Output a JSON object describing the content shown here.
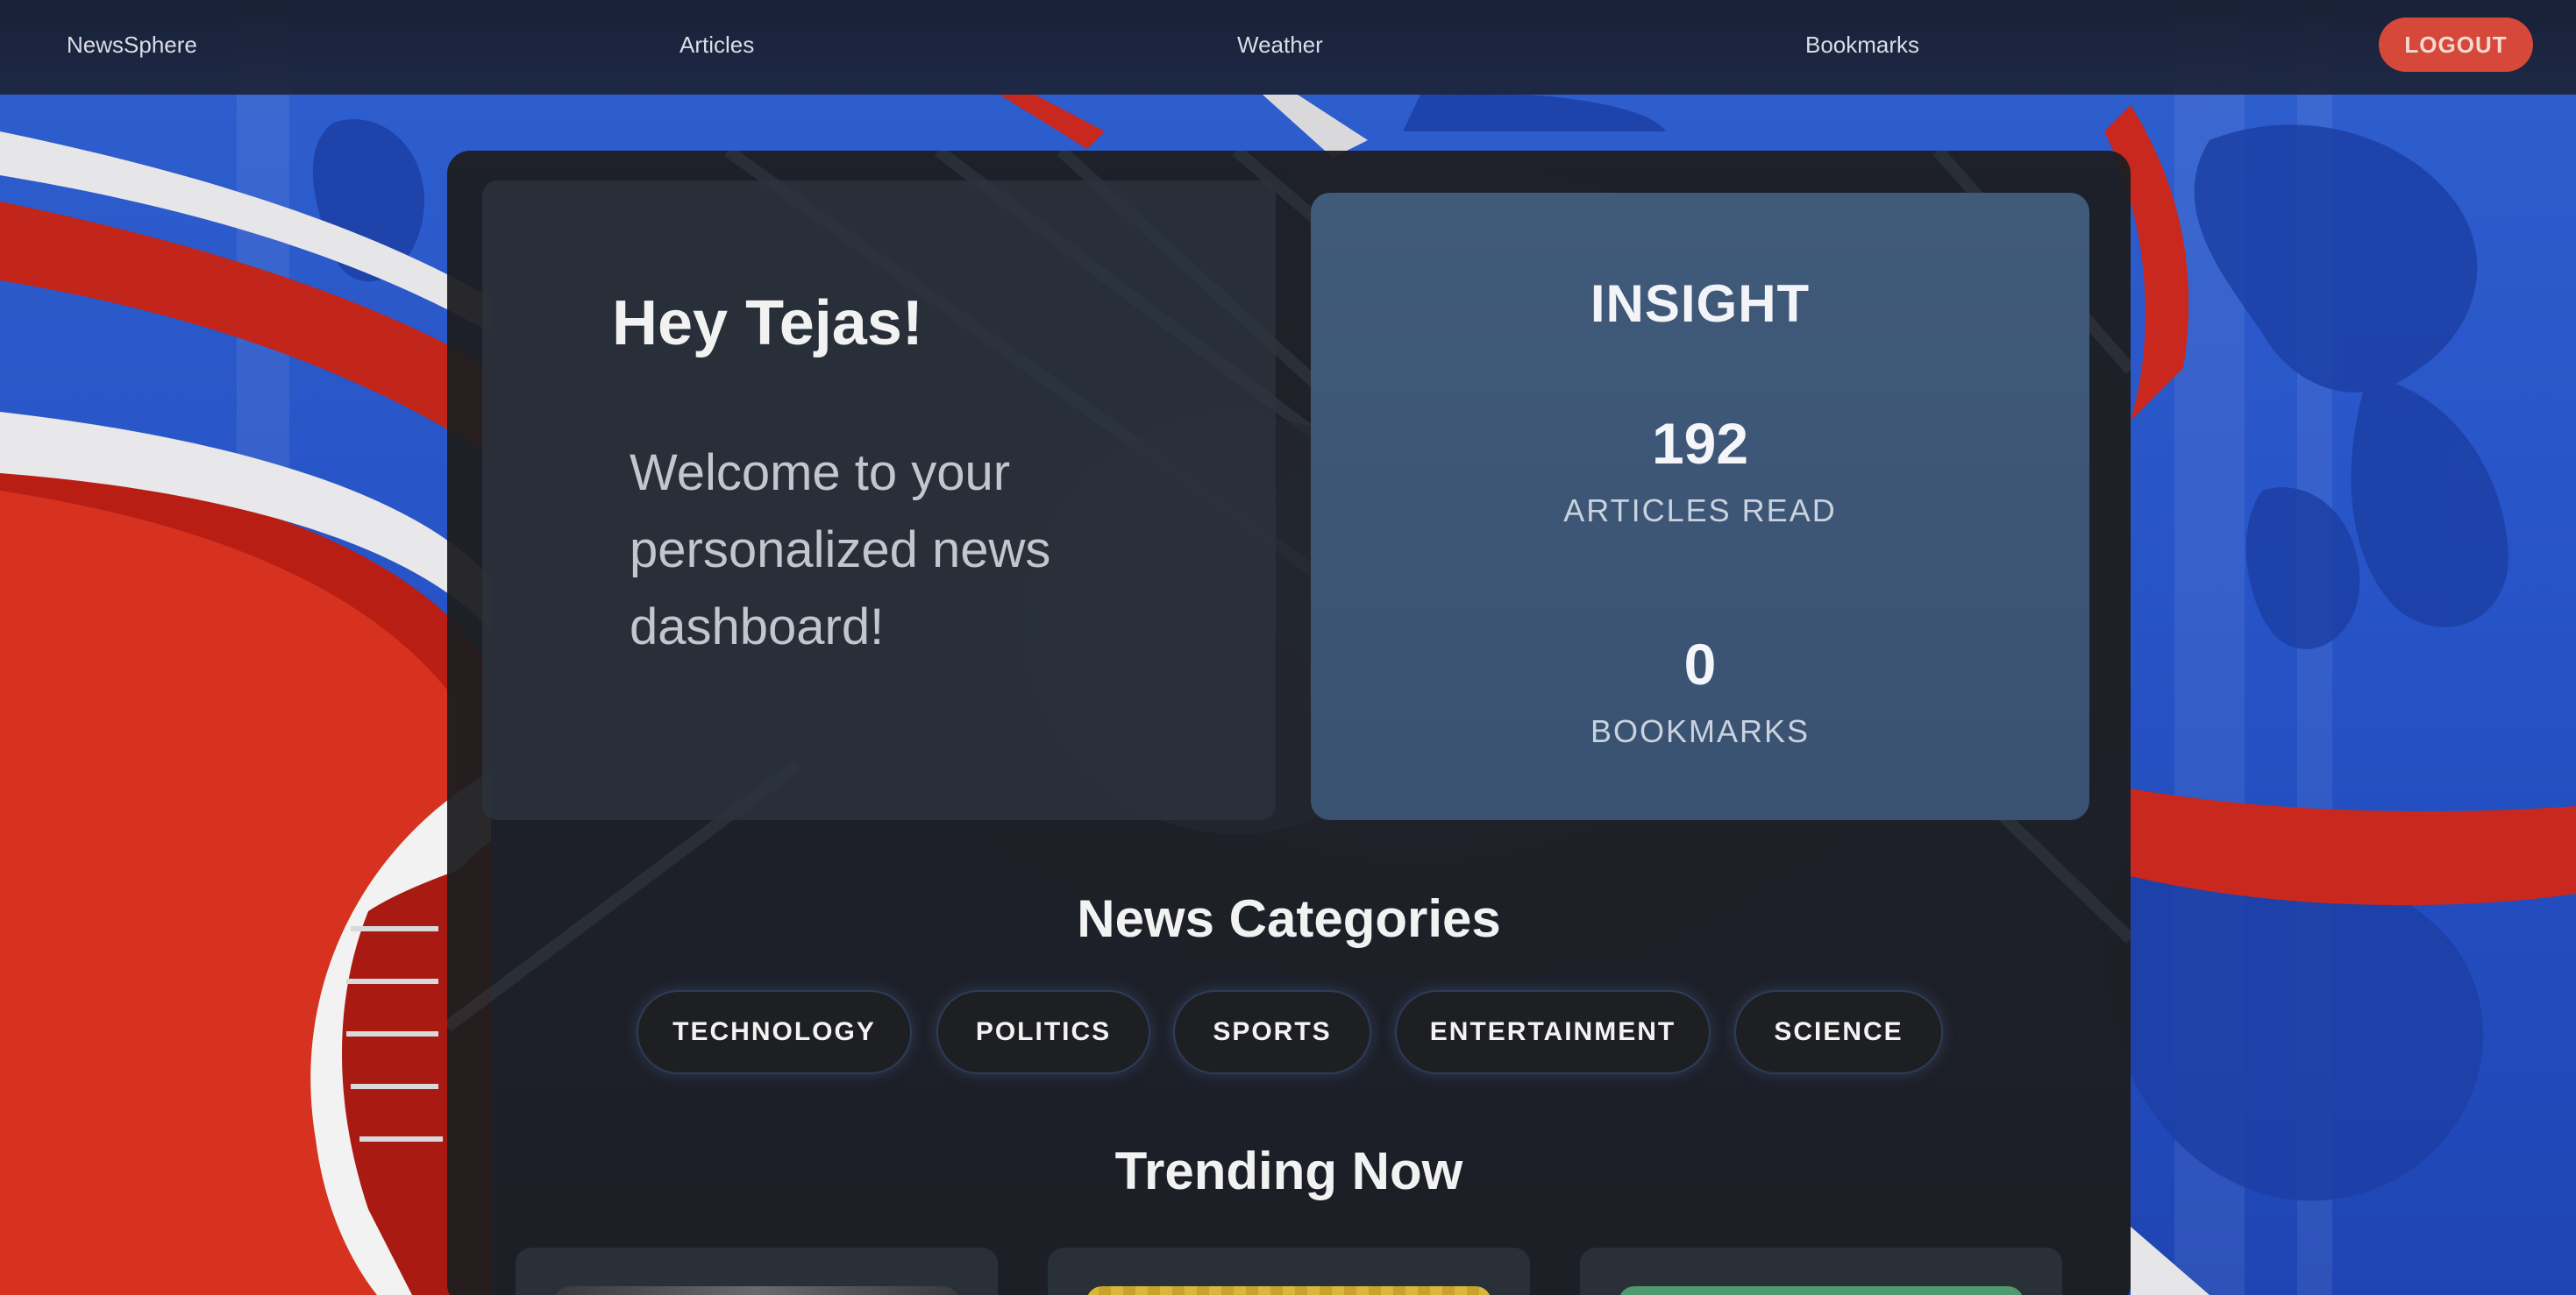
{
  "nav": {
    "brand": "NewsSphere",
    "articles": "Articles",
    "weather": "Weather",
    "bookmarks": "Bookmarks",
    "logout": "LOGOUT"
  },
  "welcome": {
    "greeting": "Hey Tejas!",
    "message": "Welcome to your personalized news dashboard!"
  },
  "insight": {
    "title": "INSIGHT",
    "articles_read_value": "192",
    "articles_read_label": "ARTICLES READ",
    "bookmarks_value": "0",
    "bookmarks_label": "BOOKMARKS"
  },
  "categories": {
    "title": "News Categories",
    "items": [
      "TECHNOLOGY",
      "POLITICS",
      "SPORTS",
      "ENTERTAINMENT",
      "SCIENCE"
    ]
  },
  "trending": {
    "title": "Trending Now"
  },
  "colors": {
    "accent_logout": "#d6483a",
    "insight_card": "#3d5574",
    "panel": "#1e1e20",
    "background_blue": "#2a58c8",
    "background_red": "#c8281e"
  }
}
